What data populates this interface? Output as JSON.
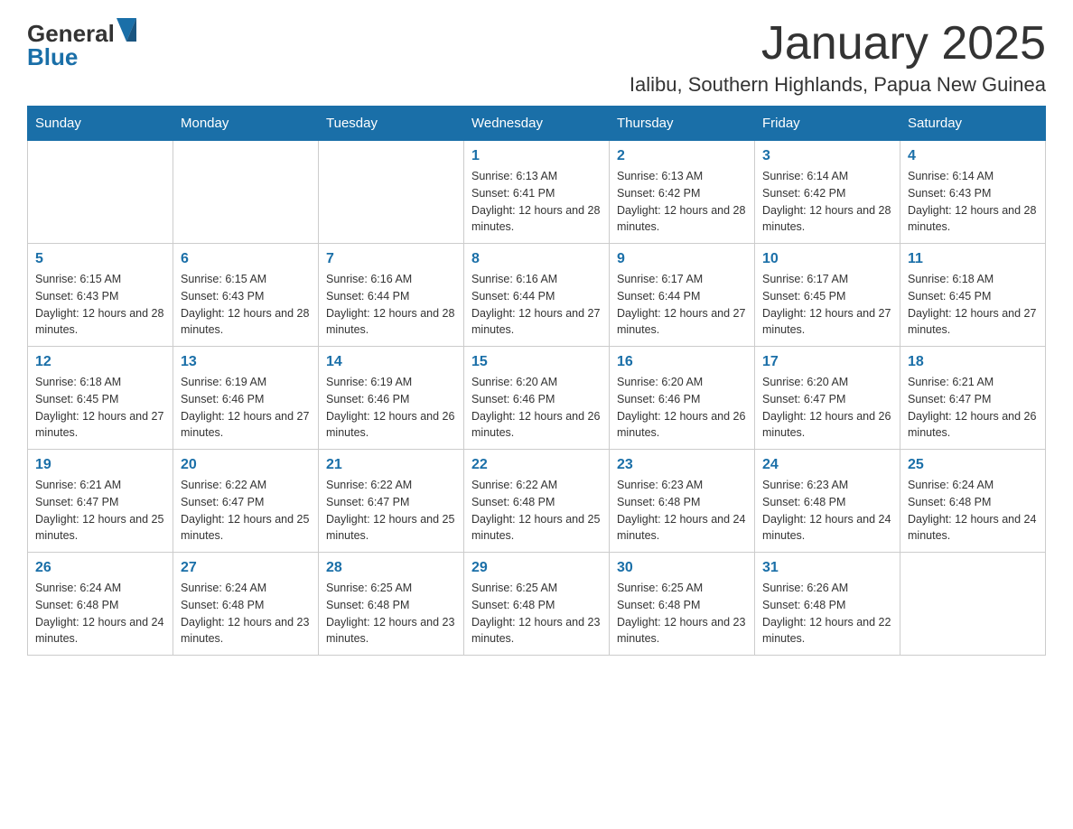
{
  "header": {
    "logo_general": "General",
    "logo_blue": "Blue",
    "month_title": "January 2025",
    "location": "Ialibu, Southern Highlands, Papua New Guinea"
  },
  "days_of_week": [
    "Sunday",
    "Monday",
    "Tuesday",
    "Wednesday",
    "Thursday",
    "Friday",
    "Saturday"
  ],
  "weeks": [
    [
      {
        "day": "",
        "info": ""
      },
      {
        "day": "",
        "info": ""
      },
      {
        "day": "",
        "info": ""
      },
      {
        "day": "1",
        "info": "Sunrise: 6:13 AM\nSunset: 6:41 PM\nDaylight: 12 hours and 28 minutes."
      },
      {
        "day": "2",
        "info": "Sunrise: 6:13 AM\nSunset: 6:42 PM\nDaylight: 12 hours and 28 minutes."
      },
      {
        "day": "3",
        "info": "Sunrise: 6:14 AM\nSunset: 6:42 PM\nDaylight: 12 hours and 28 minutes."
      },
      {
        "day": "4",
        "info": "Sunrise: 6:14 AM\nSunset: 6:43 PM\nDaylight: 12 hours and 28 minutes."
      }
    ],
    [
      {
        "day": "5",
        "info": "Sunrise: 6:15 AM\nSunset: 6:43 PM\nDaylight: 12 hours and 28 minutes."
      },
      {
        "day": "6",
        "info": "Sunrise: 6:15 AM\nSunset: 6:43 PM\nDaylight: 12 hours and 28 minutes."
      },
      {
        "day": "7",
        "info": "Sunrise: 6:16 AM\nSunset: 6:44 PM\nDaylight: 12 hours and 28 minutes."
      },
      {
        "day": "8",
        "info": "Sunrise: 6:16 AM\nSunset: 6:44 PM\nDaylight: 12 hours and 27 minutes."
      },
      {
        "day": "9",
        "info": "Sunrise: 6:17 AM\nSunset: 6:44 PM\nDaylight: 12 hours and 27 minutes."
      },
      {
        "day": "10",
        "info": "Sunrise: 6:17 AM\nSunset: 6:45 PM\nDaylight: 12 hours and 27 minutes."
      },
      {
        "day": "11",
        "info": "Sunrise: 6:18 AM\nSunset: 6:45 PM\nDaylight: 12 hours and 27 minutes."
      }
    ],
    [
      {
        "day": "12",
        "info": "Sunrise: 6:18 AM\nSunset: 6:45 PM\nDaylight: 12 hours and 27 minutes."
      },
      {
        "day": "13",
        "info": "Sunrise: 6:19 AM\nSunset: 6:46 PM\nDaylight: 12 hours and 27 minutes."
      },
      {
        "day": "14",
        "info": "Sunrise: 6:19 AM\nSunset: 6:46 PM\nDaylight: 12 hours and 26 minutes."
      },
      {
        "day": "15",
        "info": "Sunrise: 6:20 AM\nSunset: 6:46 PM\nDaylight: 12 hours and 26 minutes."
      },
      {
        "day": "16",
        "info": "Sunrise: 6:20 AM\nSunset: 6:46 PM\nDaylight: 12 hours and 26 minutes."
      },
      {
        "day": "17",
        "info": "Sunrise: 6:20 AM\nSunset: 6:47 PM\nDaylight: 12 hours and 26 minutes."
      },
      {
        "day": "18",
        "info": "Sunrise: 6:21 AM\nSunset: 6:47 PM\nDaylight: 12 hours and 26 minutes."
      }
    ],
    [
      {
        "day": "19",
        "info": "Sunrise: 6:21 AM\nSunset: 6:47 PM\nDaylight: 12 hours and 25 minutes."
      },
      {
        "day": "20",
        "info": "Sunrise: 6:22 AM\nSunset: 6:47 PM\nDaylight: 12 hours and 25 minutes."
      },
      {
        "day": "21",
        "info": "Sunrise: 6:22 AM\nSunset: 6:47 PM\nDaylight: 12 hours and 25 minutes."
      },
      {
        "day": "22",
        "info": "Sunrise: 6:22 AM\nSunset: 6:48 PM\nDaylight: 12 hours and 25 minutes."
      },
      {
        "day": "23",
        "info": "Sunrise: 6:23 AM\nSunset: 6:48 PM\nDaylight: 12 hours and 24 minutes."
      },
      {
        "day": "24",
        "info": "Sunrise: 6:23 AM\nSunset: 6:48 PM\nDaylight: 12 hours and 24 minutes."
      },
      {
        "day": "25",
        "info": "Sunrise: 6:24 AM\nSunset: 6:48 PM\nDaylight: 12 hours and 24 minutes."
      }
    ],
    [
      {
        "day": "26",
        "info": "Sunrise: 6:24 AM\nSunset: 6:48 PM\nDaylight: 12 hours and 24 minutes."
      },
      {
        "day": "27",
        "info": "Sunrise: 6:24 AM\nSunset: 6:48 PM\nDaylight: 12 hours and 23 minutes."
      },
      {
        "day": "28",
        "info": "Sunrise: 6:25 AM\nSunset: 6:48 PM\nDaylight: 12 hours and 23 minutes."
      },
      {
        "day": "29",
        "info": "Sunrise: 6:25 AM\nSunset: 6:48 PM\nDaylight: 12 hours and 23 minutes."
      },
      {
        "day": "30",
        "info": "Sunrise: 6:25 AM\nSunset: 6:48 PM\nDaylight: 12 hours and 23 minutes."
      },
      {
        "day": "31",
        "info": "Sunrise: 6:26 AM\nSunset: 6:48 PM\nDaylight: 12 hours and 22 minutes."
      },
      {
        "day": "",
        "info": ""
      }
    ]
  ]
}
